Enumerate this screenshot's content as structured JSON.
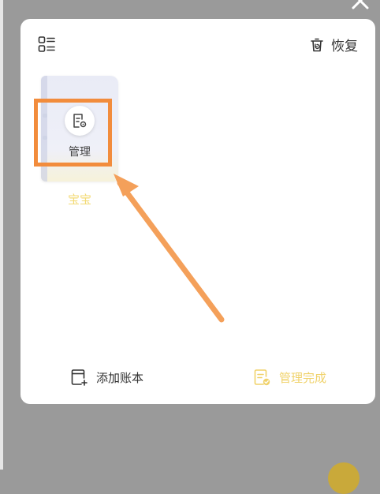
{
  "header": {
    "restore_label": "恢复",
    "list_icon": "list-view-icon",
    "restore_icon": "trash-restore-icon"
  },
  "books": [
    {
      "name": "宝宝",
      "manage_label": "管理",
      "manage_icon": "document-settings-icon"
    }
  ],
  "footer": {
    "add_label": "添加账本",
    "add_icon": "add-book-icon",
    "done_label": "管理完成",
    "done_icon": "document-check-icon"
  },
  "colors": {
    "accent_yellow": "#f0d26a",
    "annotation_orange": "#f28c3c",
    "overlay_gray": "#9a9a9a",
    "dialog_bg": "#ffffff"
  }
}
